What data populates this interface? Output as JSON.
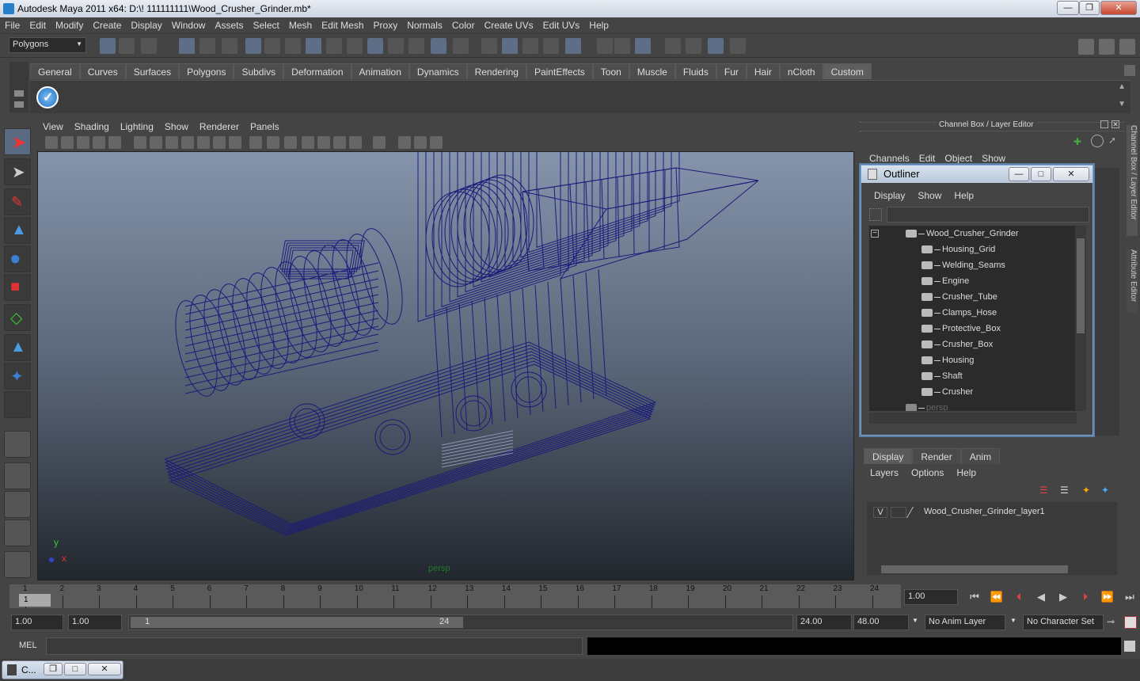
{
  "window": {
    "title": "Autodesk Maya 2011 x64: D:\\! 111111111\\Wood_Crusher_Grinder.mb*"
  },
  "menubar": [
    "File",
    "Edit",
    "Modify",
    "Create",
    "Display",
    "Window",
    "Assets",
    "Select",
    "Mesh",
    "Edit Mesh",
    "Proxy",
    "Normals",
    "Color",
    "Create UVs",
    "Edit UVs",
    "Help"
  ],
  "statusline": {
    "menu_set": "Polygons"
  },
  "shelf": {
    "tabs": [
      "General",
      "Curves",
      "Surfaces",
      "Polygons",
      "Subdivs",
      "Deformation",
      "Animation",
      "Dynamics",
      "Rendering",
      "PaintEffects",
      "Toon",
      "Muscle",
      "Fluids",
      "Fur",
      "Hair",
      "nCloth",
      "Custom"
    ],
    "active_tab": "Custom"
  },
  "viewport": {
    "menu": [
      "View",
      "Shading",
      "Lighting",
      "Show",
      "Renderer",
      "Panels"
    ],
    "camera_label": "persp",
    "axis_y": "y",
    "axis_x": "x",
    "wire_color": "#1b1b7a"
  },
  "channel_box": {
    "title": "Channel Box / Layer Editor",
    "menu": [
      "Channels",
      "Edit",
      "Object",
      "Show"
    ]
  },
  "outliner": {
    "title": "Outliner",
    "menu": [
      "Display",
      "Show",
      "Help"
    ],
    "root": "Wood_Crusher_Grinder",
    "children": [
      "Housing_Grid",
      "Welding_Seams",
      "Engine",
      "Crusher_Tube",
      "Clamps_Hose",
      "Protective_Box",
      "Crusher_Box",
      "Housing",
      "Shaft",
      "Crusher"
    ],
    "extra": "persp"
  },
  "layer_editor": {
    "tabs": [
      "Display",
      "Render",
      "Anim"
    ],
    "active_tab": "Display",
    "menu": [
      "Layers",
      "Options",
      "Help"
    ],
    "layers": [
      {
        "visible": "V",
        "name": "Wood_Crusher_Grinder_layer1"
      }
    ]
  },
  "side_tabs": [
    "Channel Box / Layer Editor",
    "Attribute Editor"
  ],
  "timeline": {
    "ticks": [
      "1",
      "2",
      "3",
      "4",
      "5",
      "6",
      "7",
      "8",
      "9",
      "10",
      "11",
      "12",
      "13",
      "14",
      "15",
      "16",
      "17",
      "18",
      "19",
      "20",
      "21",
      "22",
      "23",
      "24"
    ],
    "current_frame_label": "1",
    "current_time": "1.00"
  },
  "range": {
    "start": "1.00",
    "playback_start": "1.00",
    "slider_start": "1",
    "slider_end": "24",
    "playback_end": "24.00",
    "end": "48.00",
    "anim_layer": "No Anim Layer",
    "character_set": "No Character Set"
  },
  "command": {
    "label": "MEL"
  },
  "taskbar": {
    "item": "C..."
  }
}
